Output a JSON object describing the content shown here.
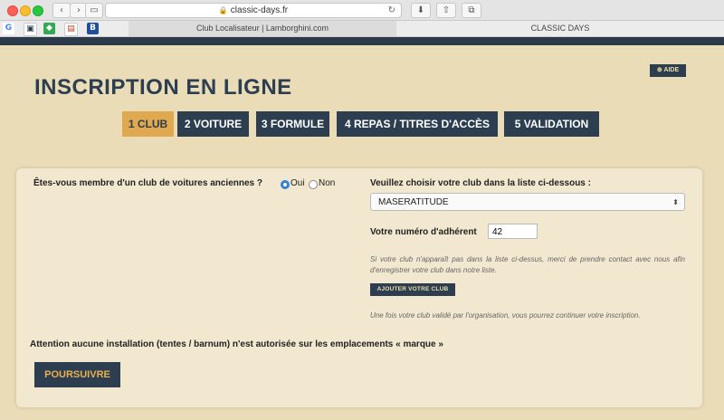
{
  "browser": {
    "url": "classic-days.fr",
    "tabs": [
      "Club Localisateur | Lamborghini.com",
      "CLASSIC DAYS"
    ]
  },
  "help_button": "AIDE",
  "page_title": "INSCRIPTION EN LIGNE",
  "steps": [
    "1 CLUB",
    "2 VOITURE",
    "3 FORMULE",
    "4 REPAS / TITRES D'ACCÈS",
    "5 VALIDATION"
  ],
  "form": {
    "question": "Êtes-vous membre d'un club de voitures anciennes ?",
    "option_yes": "Oui",
    "option_no": "Non",
    "club_prompt": "Veuillez choisir votre club dans la liste ci-dessous :",
    "club_selected": "MASERATITUDE",
    "member_number_label": "Votre numéro d'adhérent",
    "member_number_value": "42",
    "note_missing": "Si votre club n'apparaît pas dans la liste ci-dessus, merci de prendre contact avec nous afin d'enregistrer votre club dans notre liste.",
    "add_club_button": "AJOUTER VOTRE CLUB",
    "note_validated": "Une fois votre club validé par l'organisation, vous pourrez continuer votre inscription.",
    "warning": "Attention aucune installation (tentes / barnum) n'est autorisée sur les emplacements « marque »",
    "next_button": "POURSUIVRE"
  }
}
